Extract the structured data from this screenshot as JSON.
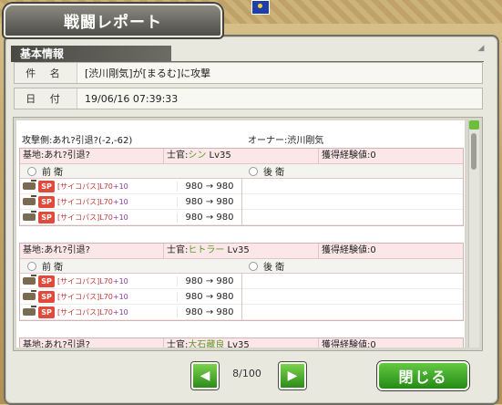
{
  "window_title": "戦闘レポート",
  "basic_info": {
    "section_title": "基本情報",
    "subject_label": "件 名",
    "subject_value": "[渋川剛気]が[まるむ]に攻撃",
    "date_label": "日 付",
    "date_value": "19/06/16 07:39:33"
  },
  "report": {
    "attacker": "攻撃側:あれ?引退?(-2,-62)",
    "owner": "オーナー:渋川剛気",
    "blocks": [
      {
        "base": "基地:あれ?引退?",
        "officer_prefix": "士官:",
        "officer_name": "シン",
        "officer_level": " Lv35",
        "exp": "獲得経験値:0",
        "front_label": "前 衛",
        "rear_label": "後 衛",
        "units": [
          {
            "type": "[サイコパス]L70",
            "bonus": "+10",
            "hp": "980 → 980"
          },
          {
            "type": "[サイコパス]L70",
            "bonus": "+10",
            "hp": "980 → 980"
          },
          {
            "type": "[サイコパス]L70",
            "bonus": "+10",
            "hp": "980 → 980"
          }
        ]
      },
      {
        "base": "基地:あれ?引退?",
        "officer_prefix": "士官:",
        "officer_name": "ヒトラー",
        "officer_level": " Lv35",
        "exp": "獲得経験値:0",
        "front_label": "前 衛",
        "rear_label": "後 衛",
        "units": [
          {
            "type": "[サイコパス]L70",
            "bonus": "+10",
            "hp": "980 → 980"
          },
          {
            "type": "[サイコパス]L70",
            "bonus": "+10",
            "hp": "980 → 980"
          },
          {
            "type": "[サイコパス]L70",
            "bonus": "+10",
            "hp": "980 → 980"
          }
        ]
      },
      {
        "base": "基地:あれ?引退?",
        "officer_prefix": "士官:",
        "officer_name": "大石藏良",
        "officer_level": " Lv35",
        "exp": "獲得経験値:0"
      }
    ],
    "sp_badge": "SP"
  },
  "pagination": {
    "current": "8/100",
    "prev_icon": "left-arrow-icon",
    "next_icon": "right-arrow-icon"
  },
  "close_label": "閉じる",
  "colors": {
    "accent_green": "#3fae26",
    "block_bg": "#fbecec",
    "officer_name": "#5c9a2a"
  }
}
